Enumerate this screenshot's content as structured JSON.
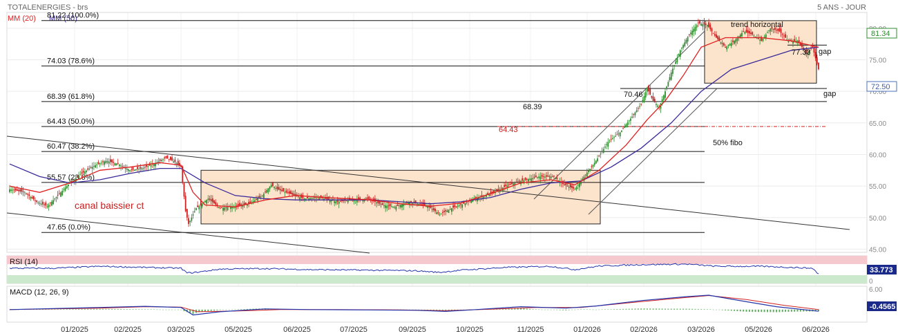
{
  "header": {
    "title": "TOTALENERGIES - brs",
    "period": "5 ANS - JOUR",
    "ma20_label": "MM (20)",
    "ma50_label": "MM (50)"
  },
  "colors": {
    "candle_up": "#2e8b2e",
    "candle_down": "#c81e1e",
    "ma20": "#e02020",
    "ma50": "#3a2a9a",
    "box_fill": "#fbe3cc",
    "rsi_line": "#2233aa",
    "macd_line": "#2233aa",
    "signal_line": "#d02020",
    "hist": "#3a9a3a"
  },
  "chart_data": [
    {
      "type": "candlestick",
      "ylim": [
        44.5,
        82.5
      ],
      "yticks": [
        "45.00",
        "50.00",
        "55.00",
        "60.00",
        "65.00",
        "70.00",
        "75.00",
        "80.00"
      ],
      "x_labels": [
        "01/2025",
        "02/2025",
        "03/2025",
        "05/2025",
        "06/2025",
        "07/2025",
        "09/2025",
        "10/2025",
        "11/2025",
        "01/2026",
        "02/2026",
        "03/2026",
        "05/2026",
        "06/2026"
      ],
      "last_price": "81.34",
      "current_price": "72.50",
      "fibonacci_levels": [
        {
          "value": 81.22,
          "label": "81.22 (100.0%)"
        },
        {
          "value": 74.03,
          "label": "74.03 (78.6%)"
        },
        {
          "value": 68.39,
          "label": "68.39 (61.8%)"
        },
        {
          "value": 64.43,
          "label": "64.43 (50.0%)"
        },
        {
          "value": 60.47,
          "label": "60.47 (38.2%)"
        },
        {
          "value": 55.57,
          "label": "55.57 (23.6%)"
        },
        {
          "value": 47.65,
          "label": "47.65 (0.0%)"
        }
      ],
      "annotations": {
        "canal": "canal baissier ct",
        "trend": "trend horizontal",
        "gap_top": "gap",
        "gap_bottom": "gap",
        "fibo50": "50% fibo",
        "level_6843": "68.39",
        "level_6443": "64.43",
        "level_7046": "70.46",
        "level_7733": "77.33"
      },
      "levels_price": {
        "level_70_46": 70.46,
        "level_77_33": 77.33,
        "gap_line": 77.33
      },
      "price_path": [
        [
          0,
          54.5
        ],
        [
          10,
          54.0
        ],
        [
          18,
          52.5
        ],
        [
          25,
          51.8
        ],
        [
          32,
          53.5
        ],
        [
          40,
          55.5
        ],
        [
          48,
          57.0
        ],
        [
          56,
          58.2
        ],
        [
          64,
          59.0
        ],
        [
          72,
          58.5
        ],
        [
          80,
          57.5
        ],
        [
          88,
          57.8
        ],
        [
          96,
          58.5
        ],
        [
          104,
          59.5
        ],
        [
          110,
          58.8
        ],
        [
          114,
          58.0
        ],
        [
          117,
          51.0
        ],
        [
          119,
          49.0
        ],
        [
          124,
          51.5
        ],
        [
          132,
          53.0
        ],
        [
          140,
          51.5
        ],
        [
          150,
          51.8
        ],
        [
          160,
          52.3
        ],
        [
          168,
          53.5
        ],
        [
          174,
          55.2
        ],
        [
          178,
          54.5
        ],
        [
          186,
          53.8
        ],
        [
          196,
          53.0
        ],
        [
          206,
          53.2
        ],
        [
          218,
          52.5
        ],
        [
          228,
          52.8
        ],
        [
          238,
          53.0
        ],
        [
          248,
          52.0
        ],
        [
          256,
          51.7
        ],
        [
          266,
          52.5
        ],
        [
          278,
          51.8
        ],
        [
          286,
          50.5
        ],
        [
          294,
          51.5
        ],
        [
          302,
          52.2
        ],
        [
          312,
          53.2
        ],
        [
          322,
          54.0
        ],
        [
          330,
          55.0
        ],
        [
          340,
          55.8
        ],
        [
          352,
          56.5
        ],
        [
          362,
          56.5
        ],
        [
          368,
          55.3
        ],
        [
          376,
          54.5
        ],
        [
          382,
          56.5
        ],
        [
          390,
          59.0
        ],
        [
          398,
          62.0
        ],
        [
          406,
          63.5
        ],
        [
          414,
          66.0
        ],
        [
          420,
          68.0
        ],
        [
          424,
          70.5
        ],
        [
          428,
          68.5
        ],
        [
          432,
          67.5
        ],
        [
          436,
          70.0
        ],
        [
          440,
          73.0
        ],
        [
          446,
          76.5
        ],
        [
          452,
          79.0
        ],
        [
          458,
          80.8
        ],
        [
          464,
          80.5
        ],
        [
          470,
          78.5
        ],
        [
          476,
          77.0
        ],
        [
          482,
          78.0
        ],
        [
          488,
          79.5
        ],
        [
          494,
          79.0
        ],
        [
          500,
          78.0
        ],
        [
          506,
          80.0
        ],
        [
          512,
          79.5
        ],
        [
          518,
          78.0
        ],
        [
          524,
          78.0
        ],
        [
          530,
          76.0
        ],
        [
          534,
          77.0
        ],
        [
          538,
          73.5
        ]
      ],
      "ma20_path": [
        [
          0,
          55.0
        ],
        [
          20,
          54.0
        ],
        [
          40,
          55.5
        ],
        [
          60,
          57.5
        ],
        [
          80,
          58.0
        ],
        [
          100,
          58.7
        ],
        [
          114,
          58.3
        ],
        [
          122,
          54.0
        ],
        [
          130,
          52.0
        ],
        [
          150,
          51.7
        ],
        [
          170,
          52.8
        ],
        [
          190,
          53.5
        ],
        [
          210,
          53.2
        ],
        [
          240,
          52.8
        ],
        [
          260,
          52.2
        ],
        [
          280,
          51.8
        ],
        [
          300,
          52.3
        ],
        [
          320,
          53.8
        ],
        [
          340,
          55.5
        ],
        [
          360,
          56.0
        ],
        [
          376,
          55.2
        ],
        [
          392,
          57.5
        ],
        [
          410,
          61.5
        ],
        [
          424,
          65.5
        ],
        [
          436,
          68.5
        ],
        [
          448,
          72.5
        ],
        [
          460,
          77.0
        ],
        [
          476,
          78.5
        ],
        [
          500,
          78.5
        ],
        [
          520,
          78.0
        ],
        [
          538,
          77.0
        ]
      ],
      "ma50_path": [
        [
          0,
          58.5
        ],
        [
          20,
          56.5
        ],
        [
          40,
          55.5
        ],
        [
          60,
          56.0
        ],
        [
          80,
          57.0
        ],
        [
          100,
          57.8
        ],
        [
          114,
          57.8
        ],
        [
          130,
          55.5
        ],
        [
          150,
          53.5
        ],
        [
          170,
          53.0
        ],
        [
          190,
          52.8
        ],
        [
          210,
          52.8
        ],
        [
          240,
          52.8
        ],
        [
          260,
          52.5
        ],
        [
          280,
          52.2
        ],
        [
          300,
          52.5
        ],
        [
          320,
          53.2
        ],
        [
          340,
          54.5
        ],
        [
          360,
          55.5
        ],
        [
          380,
          55.8
        ],
        [
          400,
          58.0
        ],
        [
          420,
          61.0
        ],
        [
          440,
          65.0
        ],
        [
          460,
          70.0
        ],
        [
          480,
          73.5
        ],
        [
          500,
          75.0
        ],
        [
          520,
          76.5
        ],
        [
          538,
          77.0
        ]
      ]
    },
    {
      "type": "line",
      "name_label": "RSI (14)",
      "value": "33.773",
      "ylim": [
        0,
        100
      ],
      "zones": [
        70,
        30
      ],
      "rsi_path": [
        [
          0,
          55
        ],
        [
          30,
          55
        ],
        [
          60,
          62
        ],
        [
          90,
          58
        ],
        [
          114,
          55
        ],
        [
          118,
          38
        ],
        [
          124,
          40
        ],
        [
          140,
          52
        ],
        [
          170,
          54
        ],
        [
          200,
          50
        ],
        [
          240,
          48
        ],
        [
          270,
          46
        ],
        [
          286,
          40
        ],
        [
          300,
          48
        ],
        [
          330,
          58
        ],
        [
          360,
          62
        ],
        [
          376,
          50
        ],
        [
          392,
          63
        ],
        [
          420,
          68
        ],
        [
          450,
          70
        ],
        [
          470,
          62
        ],
        [
          500,
          62
        ],
        [
          520,
          58
        ],
        [
          534,
          55
        ],
        [
          538,
          34
        ]
      ]
    },
    {
      "type": "line",
      "name_label": "MACD (12, 26, 9)",
      "value": "-0.4565",
      "zero_label": "0",
      "upper_label": "6.00",
      "ylim": [
        -3.5,
        6.5
      ],
      "macd_path": [
        [
          0,
          0.0
        ],
        [
          60,
          0.6
        ],
        [
          90,
          0.9
        ],
        [
          114,
          0.6
        ],
        [
          122,
          -1.5
        ],
        [
          140,
          -0.6
        ],
        [
          170,
          0.2
        ],
        [
          200,
          0.0
        ],
        [
          240,
          -0.1
        ],
        [
          270,
          -0.2
        ],
        [
          290,
          -0.5
        ],
        [
          310,
          0.0
        ],
        [
          340,
          0.8
        ],
        [
          370,
          0.4
        ],
        [
          390,
          1.0
        ],
        [
          420,
          2.5
        ],
        [
          450,
          3.6
        ],
        [
          465,
          4.0
        ],
        [
          490,
          2.2
        ],
        [
          510,
          0.8
        ],
        [
          538,
          -0.4565
        ]
      ],
      "signal_path": [
        [
          0,
          0.0
        ],
        [
          60,
          0.4
        ],
        [
          90,
          0.8
        ],
        [
          114,
          0.7
        ],
        [
          125,
          -0.6
        ],
        [
          150,
          -0.4
        ],
        [
          180,
          0.0
        ],
        [
          220,
          0.0
        ],
        [
          260,
          -0.1
        ],
        [
          290,
          -0.3
        ],
        [
          320,
          0.1
        ],
        [
          350,
          0.6
        ],
        [
          380,
          0.6
        ],
        [
          410,
          1.8
        ],
        [
          440,
          3.0
        ],
        [
          465,
          3.9
        ],
        [
          490,
          2.8
        ],
        [
          515,
          1.2
        ],
        [
          538,
          0.0
        ]
      ]
    }
  ]
}
